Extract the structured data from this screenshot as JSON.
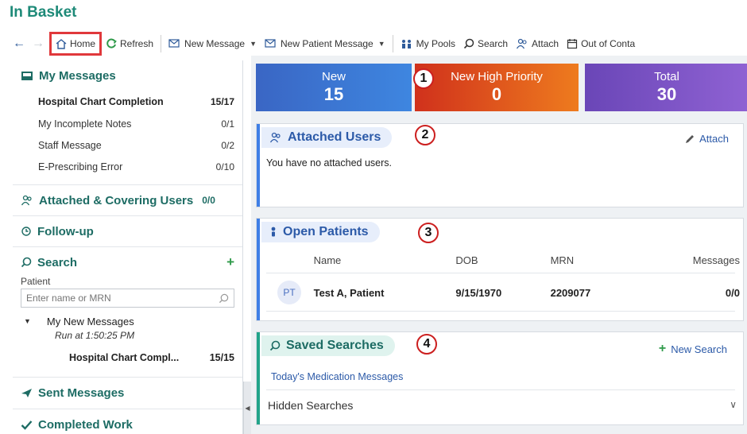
{
  "app": {
    "title": "In Basket"
  },
  "toolbar": {
    "home": "Home",
    "refresh": "Refresh",
    "new_message": "New Message",
    "new_patient_message": "New Patient Message",
    "my_pools": "My Pools",
    "search": "Search",
    "attach": "Attach",
    "out_of_contact": "Out of Conta"
  },
  "sidebar": {
    "my_messages": {
      "title": "My Messages",
      "items": [
        {
          "label": "Hospital Chart Completion",
          "count": "15/17",
          "bold": true
        },
        {
          "label": "My Incomplete Notes",
          "count": "0/1"
        },
        {
          "label": "Staff Message",
          "count": "0/2"
        },
        {
          "label": "E-Prescribing Error",
          "count": "0/10"
        }
      ]
    },
    "attached_covering": {
      "title": "Attached & Covering Users",
      "count": "0/0"
    },
    "follow_up": {
      "title": "Follow-up"
    },
    "search": {
      "title": "Search",
      "patient_label": "Patient",
      "placeholder": "Enter name or MRN",
      "saved": {
        "title": "My New Messages",
        "run_at": "Run at 1:50:25 PM",
        "item_label": "Hospital Chart Compl...",
        "item_count": "15/15"
      }
    },
    "sent": {
      "title": "Sent Messages"
    },
    "completed": {
      "title": "Completed Work"
    }
  },
  "tiles": [
    {
      "label": "New",
      "value": "15"
    },
    {
      "label": "New High Priority",
      "value": "0"
    },
    {
      "label": "Total",
      "value": "30"
    }
  ],
  "badges": [
    "1",
    "2",
    "3",
    "4"
  ],
  "attached_users": {
    "title": "Attached Users",
    "attach_link": "Attach",
    "empty": "You have no attached users."
  },
  "open_patients": {
    "title": "Open Patients",
    "columns": [
      "Name",
      "DOB",
      "MRN",
      "Messages"
    ],
    "rows": [
      {
        "initials": "PT",
        "name": "Test A, Patient",
        "dob": "9/15/1970",
        "mrn": "2209077",
        "messages": "0/0"
      }
    ]
  },
  "saved_searches": {
    "title": "Saved Searches",
    "new_search": "New Search",
    "items": [
      "Today's Medication Messages"
    ],
    "hidden_label": "Hidden Searches"
  },
  "colors": {
    "accent": "#1e8a78",
    "highlight_box": "#e0383b",
    "link": "#2c5aa8"
  }
}
